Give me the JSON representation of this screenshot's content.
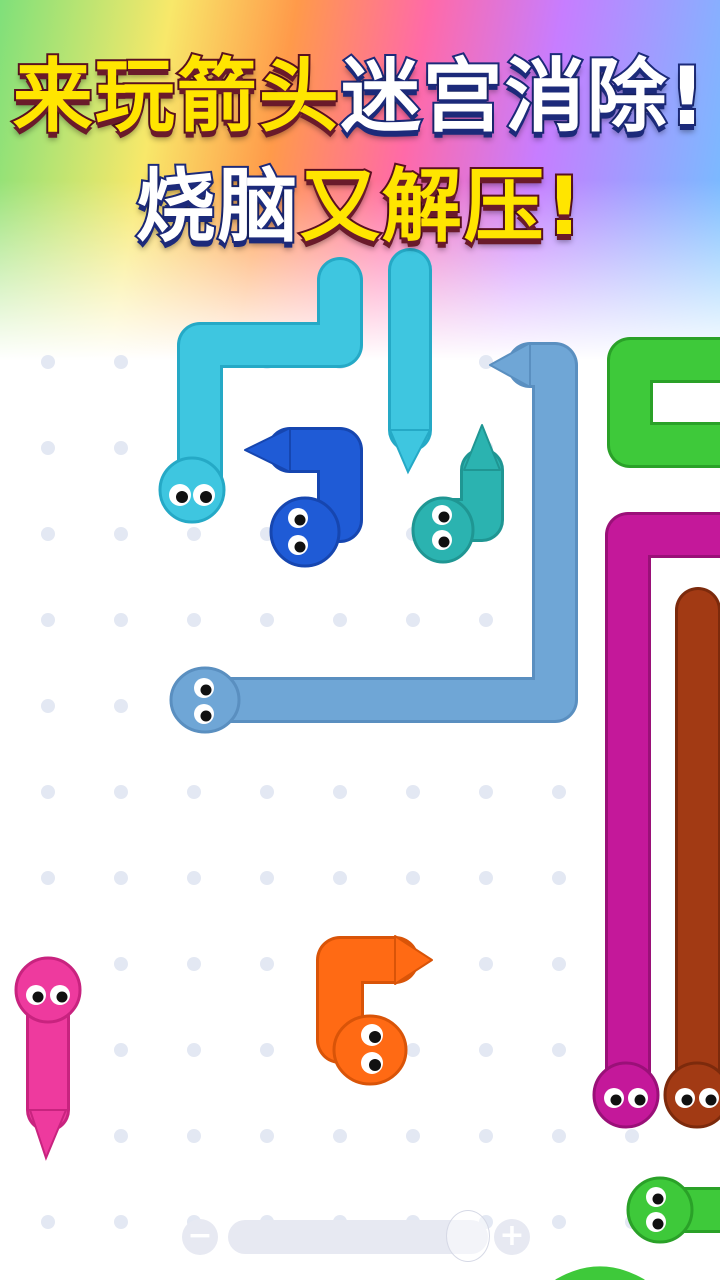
{
  "headline": {
    "line1_yellow": "来玩箭头",
    "line1_white": "迷宫消除!",
    "line2_yellow": "烧脑",
    "line2_white": "又解压!"
  },
  "colors": {
    "cyan": "#3ec6e0",
    "blue": "#1f5bd6",
    "teal": "#2bb3b0",
    "steel_blue": "#6fa6d6",
    "green": "#3ec93a",
    "magenta": "#c4189a",
    "brown": "#a23a14",
    "orange": "#ff6a14",
    "pink": "#ee3a9e"
  },
  "zoom_control": {
    "minus_label": "−",
    "plus_label": "+"
  },
  "worms": [
    {
      "id": "cyan-worm",
      "color": "cyan"
    },
    {
      "id": "light-cyan-worm",
      "color": "cyan"
    },
    {
      "id": "blue-worm",
      "color": "blue"
    },
    {
      "id": "teal-worm",
      "color": "teal"
    },
    {
      "id": "steel-blue-worm",
      "color": "steel_blue"
    },
    {
      "id": "green-worm-top",
      "color": "green"
    },
    {
      "id": "magenta-worm",
      "color": "magenta"
    },
    {
      "id": "brown-worm",
      "color": "brown"
    },
    {
      "id": "orange-worm",
      "color": "orange"
    },
    {
      "id": "pink-worm",
      "color": "pink"
    },
    {
      "id": "green-worm-bottom",
      "color": "green"
    }
  ]
}
